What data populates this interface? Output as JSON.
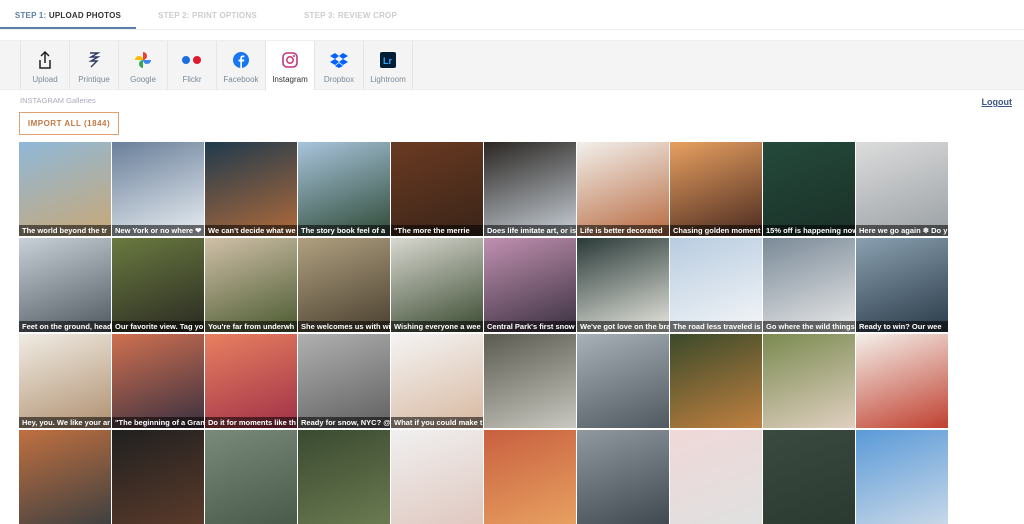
{
  "steps": [
    {
      "num": "STEP 1:",
      "label": "UPLOAD PHOTOS"
    },
    {
      "num": "STEP 2:",
      "label": "PRINT OPTIONS"
    },
    {
      "num": "STEP 3:",
      "label": "REVIEW CROP"
    }
  ],
  "sources": [
    {
      "label": "Upload",
      "icon": "upload-icon"
    },
    {
      "label": "Printique",
      "icon": "printique-icon"
    },
    {
      "label": "Google",
      "icon": "google-photos-icon"
    },
    {
      "label": "Flickr",
      "icon": "flickr-icon"
    },
    {
      "label": "Facebook",
      "icon": "facebook-icon"
    },
    {
      "label": "Instagram",
      "icon": "instagram-icon"
    },
    {
      "label": "Dropbox",
      "icon": "dropbox-icon"
    },
    {
      "label": "Lightroom",
      "icon": "lightroom-icon"
    }
  ],
  "active_source": "Instagram",
  "gallery_label": "INSTAGRAM Galleries",
  "logout": "Logout",
  "import_button": "IMPORT ALL (1844)",
  "accent": "#5a7fa8",
  "tiles": [
    {
      "caption": "The world beyond the tr",
      "c": [
        "#8fb8d8",
        "#c9a877"
      ]
    },
    {
      "caption": "New York or no where ❤",
      "c": [
        "#6a7f9a",
        "#e8eef2"
      ]
    },
    {
      "caption": "We can't decide what we",
      "c": [
        "#1f3a4d",
        "#b06a3a"
      ]
    },
    {
      "caption": "The story book feel of a",
      "c": [
        "#a8c4dc",
        "#2e4a36"
      ]
    },
    {
      "caption": "\"The more the merrie",
      "c": [
        "#6a3a22",
        "#3a2418"
      ]
    },
    {
      "caption": "Does life imitate art, or is",
      "c": [
        "#2a2622",
        "#c8d0d8"
      ]
    },
    {
      "caption": "Life is better decorated",
      "c": [
        "#f2f0ec",
        "#b86a40"
      ]
    },
    {
      "caption": "Chasing golden moment",
      "c": [
        "#e8a060",
        "#4a2a20"
      ]
    },
    {
      "caption": "15% off is happening now",
      "c": [
        "#244a3a",
        "#1a3028"
      ]
    },
    {
      "caption": "Here we go again ❄ Do y",
      "c": [
        "#dcdcdc",
        "#9aa0a4"
      ]
    },
    {
      "caption": "Feet on the ground, head",
      "c": [
        "#c8d0d8",
        "#505860"
      ]
    },
    {
      "caption": "Our favorite view. Tag yo",
      "c": [
        "#6a7a40",
        "#2a2a22"
      ]
    },
    {
      "caption": "You're far from underwh",
      "c": [
        "#d0c0a8",
        "#4a5a30"
      ]
    },
    {
      "caption": "She welcomes us with wi",
      "c": [
        "#b0a080",
        "#4a4030"
      ]
    },
    {
      "caption": "Wishing everyone a wee",
      "c": [
        "#d8d8d0",
        "#3a4a30"
      ]
    },
    {
      "caption": "Central Park's first snow",
      "c": [
        "#c090b0",
        "#3a3040"
      ]
    },
    {
      "caption": "We've got love on the bra",
      "c": [
        "#2a3a38",
        "#e8e8e0"
      ]
    },
    {
      "caption": "The road less traveled is",
      "c": [
        "#b8cce0",
        "#f4f6f8"
      ]
    },
    {
      "caption": "Go where the wild things",
      "c": [
        "#7a8a98",
        "#e8e8e8"
      ]
    },
    {
      "caption": "Ready to win?  Our wee",
      "c": [
        "#8aa0b0",
        "#2a3a48"
      ]
    },
    {
      "caption": "Hey, you. We like your ar",
      "c": [
        "#f0ece4",
        "#b09070"
      ]
    },
    {
      "caption": "\"The beginning of a Gran",
      "c": [
        "#d07050",
        "#3a3040"
      ]
    },
    {
      "caption": "Do it for moments like th",
      "c": [
        "#e88060",
        "#a03048"
      ]
    },
    {
      "caption": "Ready for snow, NYC? @",
      "c": [
        "#b0b0b0",
        "#606060"
      ]
    },
    {
      "caption": "What if you could make t",
      "c": [
        "#f4f4f4",
        "#d8b8a0"
      ]
    },
    {
      "caption": "",
      "c": [
        "#5a5a50",
        "#c8c8c0"
      ]
    },
    {
      "caption": "",
      "c": [
        "#a8b0b8",
        "#505860"
      ]
    },
    {
      "caption": "",
      "c": [
        "#3a4a2a",
        "#c08040"
      ]
    },
    {
      "caption": "",
      "c": [
        "#7a8a50",
        "#e0d0c0"
      ]
    },
    {
      "caption": "",
      "c": [
        "#f4f0ea",
        "#c04030"
      ]
    },
    {
      "caption": "",
      "c": [
        "#c07040",
        "#404040"
      ]
    },
    {
      "caption": "",
      "c": [
        "#202020",
        "#5a3a2a"
      ]
    },
    {
      "caption": "",
      "c": [
        "#7a8a7a",
        "#4a5a4a"
      ]
    },
    {
      "caption": "",
      "c": [
        "#3a4a30",
        "#6a7a50"
      ]
    },
    {
      "caption": "",
      "c": [
        "#f0f0f0",
        "#e0c8c0"
      ]
    },
    {
      "caption": "",
      "c": [
        "#c86040",
        "#e8a060"
      ]
    },
    {
      "caption": "",
      "c": [
        "#9098a0",
        "#404850"
      ]
    },
    {
      "caption": "",
      "c": [
        "#f0d8d8",
        "#e0e0e0"
      ]
    },
    {
      "caption": "",
      "c": [
        "#3a4a40",
        "#2a3a30"
      ]
    },
    {
      "caption": "",
      "c": [
        "#5a9ad8",
        "#c8d8e8"
      ]
    }
  ]
}
